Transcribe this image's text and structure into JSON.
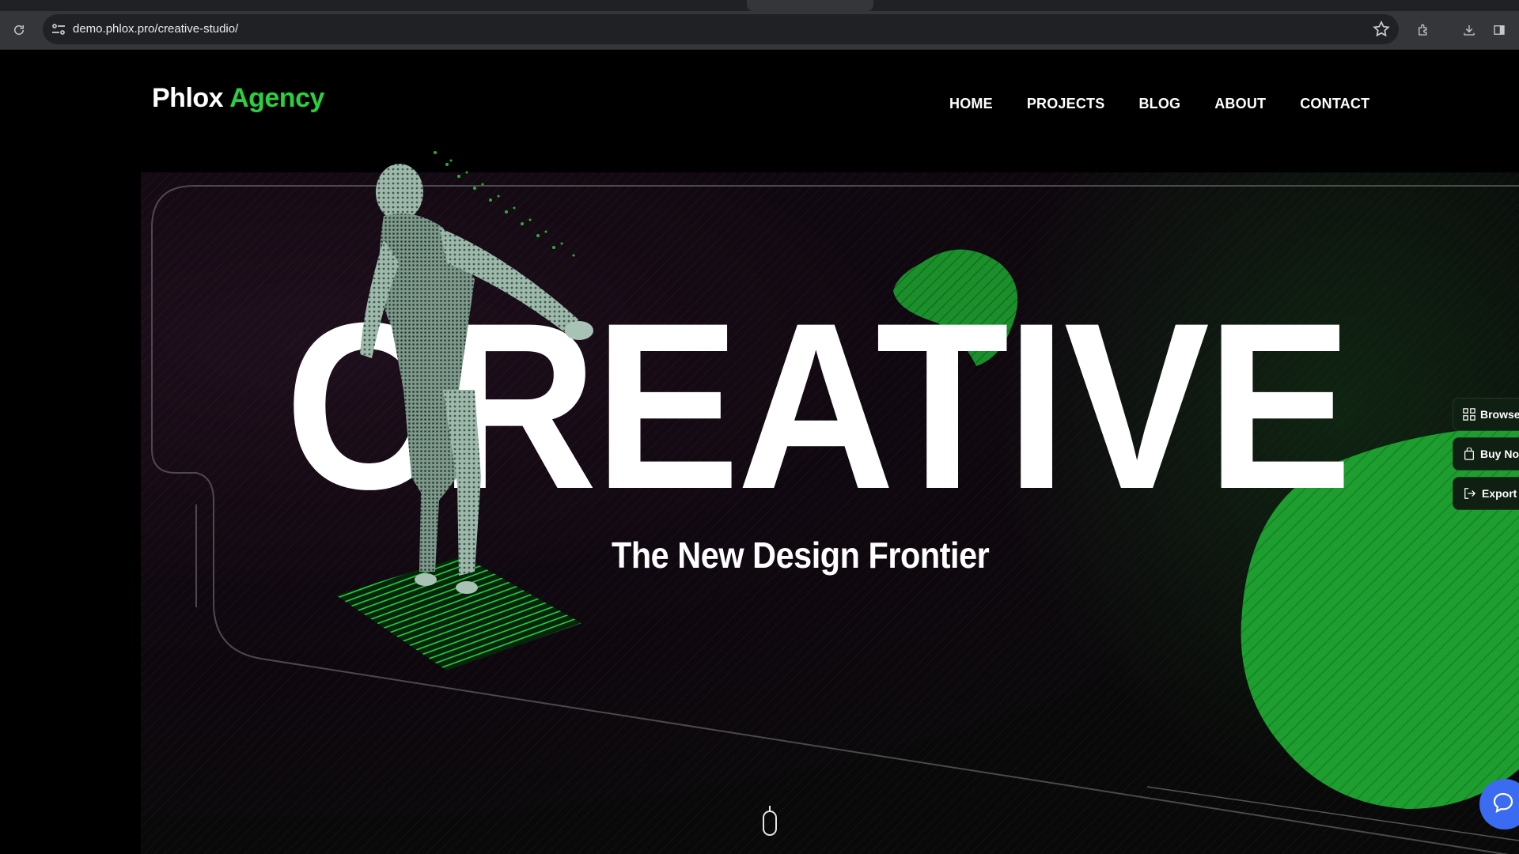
{
  "browser": {
    "url": "demo.phlox.pro/creative-studio/"
  },
  "header": {
    "logo_primary": "Phlox",
    "logo_accent": "Agency",
    "nav": [
      "HOME",
      "PROJECTS",
      "BLOG",
      "ABOUT",
      "CONTACT"
    ]
  },
  "hero": {
    "title": "CREATIVE",
    "subtitle": "The New Design Frontier"
  },
  "side_panel": [
    {
      "label": "Browse",
      "icon": "grid-icon"
    },
    {
      "label": "Buy No",
      "icon": "bag-icon"
    },
    {
      "label": "Export",
      "icon": "export-icon"
    }
  ],
  "colors": {
    "accent_green": "#2ad03e",
    "blob_green": "#1d9e2e",
    "chat_blue": "#3b6bf0",
    "background": "#000000"
  }
}
